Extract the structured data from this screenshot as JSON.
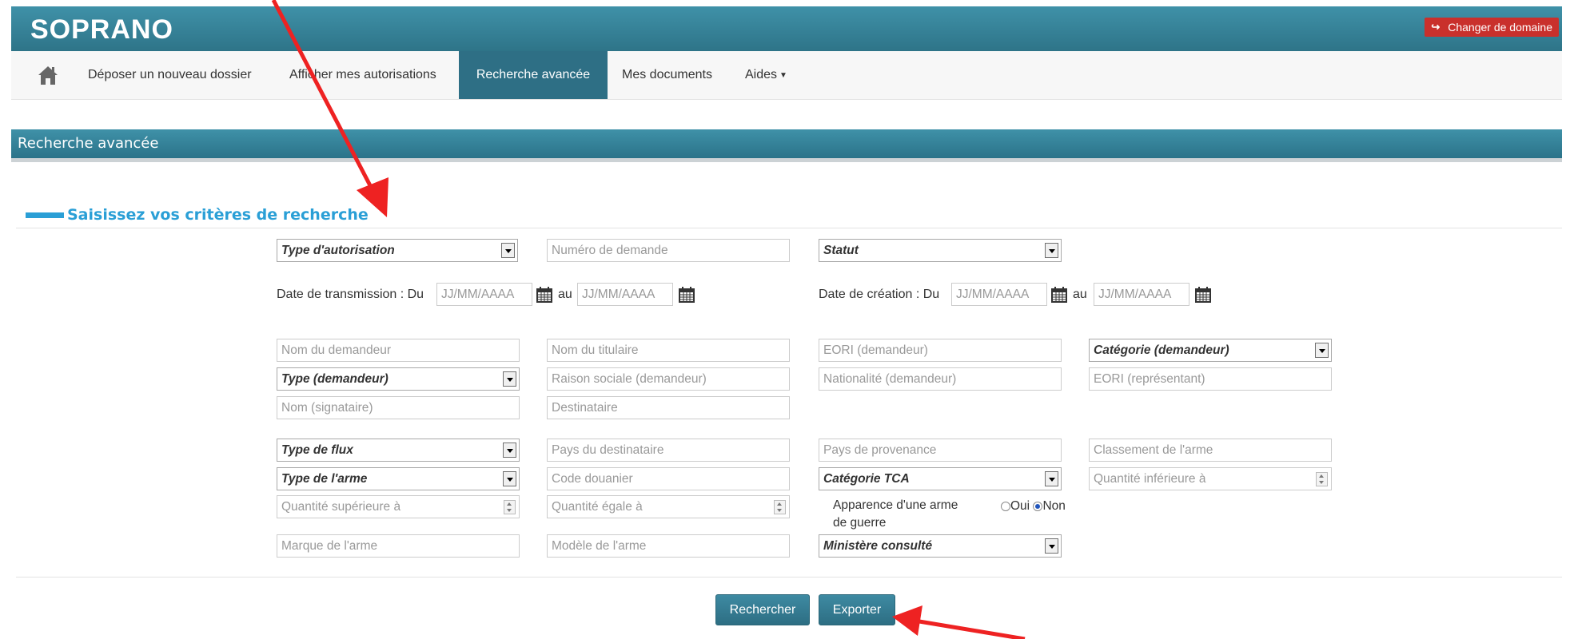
{
  "app": {
    "brand": "SOPRANO",
    "change_domain": "Changer de domaine"
  },
  "nav": {
    "home_icon": "home-icon",
    "items": [
      "Déposer un nouveau dossier",
      "Afficher mes autorisations",
      "Recherche avancée",
      "Mes documents",
      "Aides"
    ],
    "active": "Recherche avancée"
  },
  "page": {
    "title": "Recherche avancée",
    "section": "Saisissez vos critères de recherche"
  },
  "form": {
    "type_autorisation": "Type d'autorisation",
    "numero_demande": "Numéro de demande",
    "statut": "Statut",
    "date_transmission_label": "Date de transmission : Du",
    "date_creation_label": "Date de création : Du",
    "au": "au",
    "date_placeholder": "JJ/MM/AAAA",
    "nom_demandeur": "Nom du demandeur",
    "nom_titulaire": "Nom du titulaire",
    "eori_demandeur": "EORI (demandeur)",
    "categorie_demandeur": "Catégorie (demandeur)",
    "type_demandeur": "Type (demandeur)",
    "raison_sociale": "Raison sociale (demandeur)",
    "nationalite": "Nationalité (demandeur)",
    "eori_representant": "EORI (représentant)",
    "nom_signataire": "Nom (signataire)",
    "destinataire": "Destinataire",
    "type_flux": "Type de flux",
    "pays_destinataire": "Pays du destinataire",
    "pays_provenance": "Pays de provenance",
    "classement_arme": "Classement de l'arme",
    "type_arme": "Type de l'arme",
    "code_douanier": "Code douanier",
    "categorie_tca": "Catégorie TCA",
    "quantite_inferieure": "Quantité inférieure à",
    "quantite_superieure": "Quantité supérieure à",
    "quantite_egale": "Quantité égale à",
    "apparence_line1": "Apparence d'une arme",
    "apparence_line2": "de guerre",
    "oui": "Oui",
    "non": "Non",
    "apparence_value": "Non",
    "marque_arme": "Marque de l'arme",
    "modele_arme": "Modèle de l'arme",
    "ministere": "Ministère consulté"
  },
  "actions": {
    "search": "Rechercher",
    "export": "Exporter"
  },
  "colors": {
    "header": "#2e7488",
    "accent": "#2a9fd6",
    "annotation": "#ee2222",
    "danger": "#c9302c"
  }
}
